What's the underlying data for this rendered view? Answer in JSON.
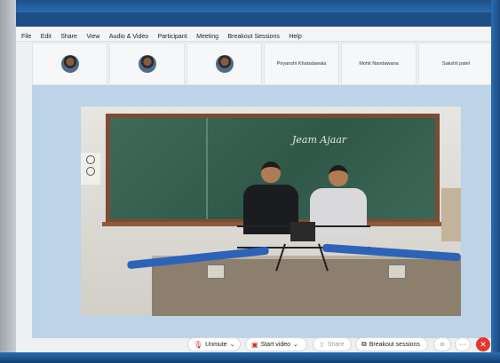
{
  "window": {
    "title_fragment": "",
    "badge": ""
  },
  "menu": [
    "File",
    "Edit",
    "Share",
    "View",
    "Audio & Video",
    "Participant",
    "Meeting",
    "Breakout Sessions",
    "Help"
  ],
  "participants": [
    {
      "name": ""
    },
    {
      "name": ""
    },
    {
      "name": ""
    },
    {
      "name": "Priyanshi Khatsdawala"
    },
    {
      "name": "Mohit Nandawana"
    },
    {
      "name": "Sakshil patel"
    }
  ],
  "stage": {
    "chalk_text": "Jeam Ajaar"
  },
  "toolbar": {
    "unmute_label": "Unmute",
    "start_video_label": "Start video",
    "share_label": "Share",
    "breakout_label": "Breakout sessions",
    "more_label": "···",
    "leave_label": "✕"
  },
  "icons": {
    "mic": "mic-muted-icon",
    "camera": "camera-off-icon",
    "share": "share-icon",
    "breakout": "breakout-icon",
    "reactions": "smile-icon",
    "leave": "close-icon"
  },
  "colors": {
    "accent": "#2a6cb0",
    "stage_bg": "#bcd3e8",
    "leave": "#e0392b",
    "muted": "#d0342c"
  }
}
